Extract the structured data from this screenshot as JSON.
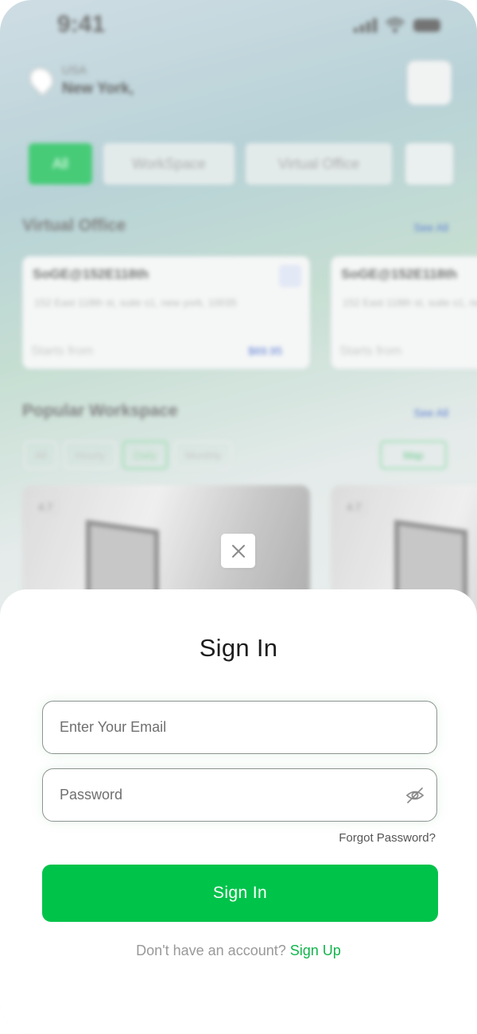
{
  "background": {
    "status_time": "9:41",
    "location_country": "USA",
    "location_city": "New York,",
    "chips": [
      "All",
      "WorkSpace",
      "Virtual Office"
    ],
    "virtual_office": {
      "title": "Virtual Office",
      "see_all": "See All",
      "cards": [
        {
          "name": "SoGE@152E118th",
          "address": "152 East 118th st, suite s1, new york, 10035",
          "starts_from": "Starts from",
          "price": "$69.95"
        },
        {
          "name": "SoGE@152E118th",
          "address": "152 East 118th st, suite s1, new york, 10035",
          "starts_from": "Starts from",
          "price": ""
        }
      ]
    },
    "popular": {
      "title": "Popular Workspace",
      "see_all": "See All",
      "tabs": [
        "All",
        "Hourly",
        "Daily",
        "Monthly"
      ],
      "map_label": "Map",
      "ratings": [
        "4.7",
        "4.7"
      ]
    }
  },
  "sheet": {
    "title": "Sign In",
    "email_placeholder": "Enter Your Email",
    "password_placeholder": "Password",
    "forgot_password": "Forgot Password?",
    "submit_label": "Sign In",
    "no_account_text": "Don't have an account?",
    "signup_label": "Sign Up"
  },
  "colors": {
    "primary": "#00c34a",
    "link": "#11b54c",
    "title": "#1d1d1d"
  },
  "icons": {
    "close": "close-icon",
    "password_toggle": "eye-off-icon"
  }
}
